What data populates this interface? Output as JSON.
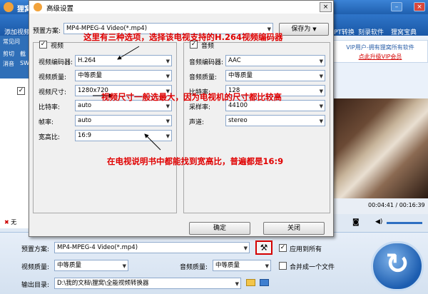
{
  "app": {
    "title": "狸窝",
    "menu": [
      "添加视频",
      "PT转换",
      "刻录软件",
      "狸窝宝典"
    ],
    "left_tools": [
      "常见问",
      "剪切",
      "截",
      "消音",
      "SW"
    ],
    "vip_text": "VIP用户-拥有狸窝所有软件",
    "vip_link": "点此升级VIP会员",
    "time": "00:04:41 / 00:16:39",
    "left_remove": "无"
  },
  "bottom": {
    "preset_label": "预置方案:",
    "preset_value": "MP4-MPEG-4 Video(*.mp4)",
    "apply_all": "应用到所有",
    "video_quality_label": "视频质量:",
    "video_quality_value": "中等质量",
    "audio_quality_label": "音频质量:",
    "audio_quality_value": "中等质量",
    "merge_label": "合并成一个文件",
    "output_label": "输出目录:",
    "output_value": "D:\\我的文档\\狸窝\\全能视频转换器"
  },
  "dialog": {
    "title": "高级设置",
    "preset_label": "预置方案:",
    "preset_value": "MP4-MPEG-4 Video(*.mp4)",
    "save_as": "保存为",
    "video_group": "视频",
    "audio_group": "音频",
    "video_rows": [
      {
        "label": "视频编码器:",
        "value": "H.264"
      },
      {
        "label": "视频质量:",
        "value": "中等质量"
      },
      {
        "label": "视频尺寸:",
        "value": "1280x720"
      },
      {
        "label": "比特率:",
        "value": "auto"
      },
      {
        "label": "帧率:",
        "value": "auto"
      },
      {
        "label": "宽高比:",
        "value": "16:9"
      }
    ],
    "audio_rows": [
      {
        "label": "音频编码器:",
        "value": "AAC"
      },
      {
        "label": "音频质量:",
        "value": "中等质量"
      },
      {
        "label": "比特率:",
        "value": "128"
      },
      {
        "label": "采样率:",
        "value": "44100"
      },
      {
        "label": "声道:",
        "value": "stereo"
      }
    ],
    "ok": "确定",
    "close": "关闭"
  },
  "notes": [
    "这里有三种选项，选择该电视支持的H.264视频编码器",
    "视频尺寸一般选最大，因为电视机的尺寸都比较高",
    "在电视说明书中都能找到宽高比，普遍都是16:9"
  ]
}
